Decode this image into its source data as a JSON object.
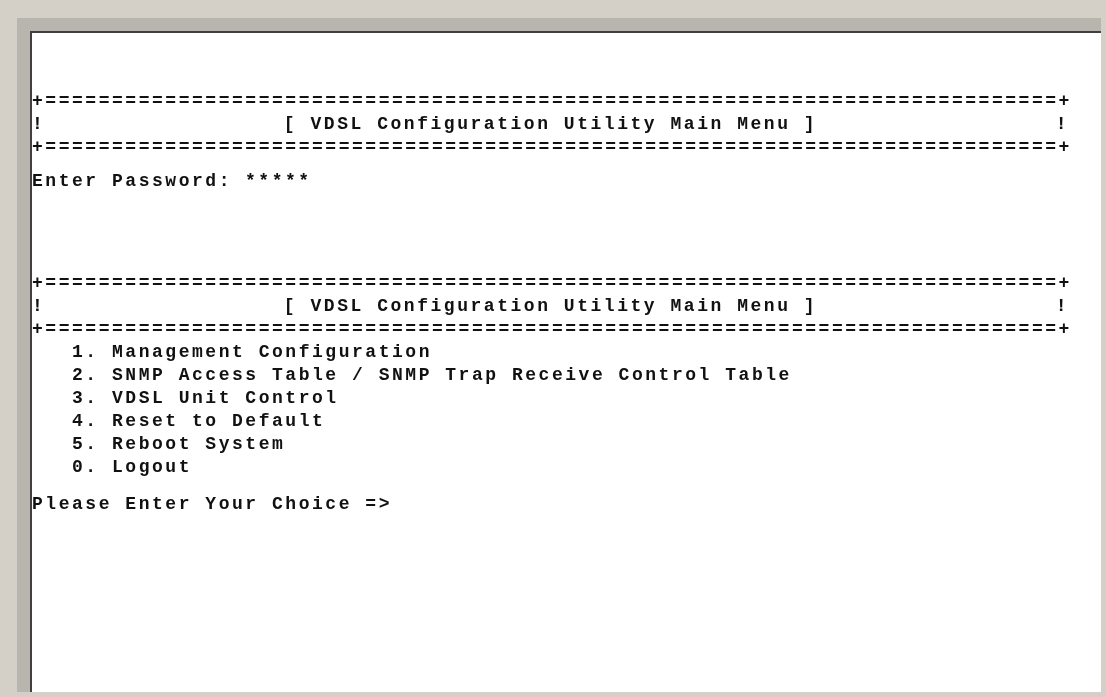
{
  "screens": [
    {
      "border_top": "+============================================================================+",
      "left_edge": "!",
      "title": "[ VDSL Configuration Utility Main Menu ]",
      "right_edge": "!",
      "border_bottom": "+============================================================================+"
    },
    {
      "border_top": "+============================================================================+",
      "left_edge": "!",
      "title": "[ VDSL Configuration Utility Main Menu ]",
      "right_edge": "!",
      "border_bottom": "+============================================================================+"
    }
  ],
  "password": {
    "label": "Enter Password:",
    "value": "*****"
  },
  "menu_items": [
    "1. Management Configuration",
    "2. SNMP Access Table / SNMP Trap Receive Control Table",
    "3. VDSL Unit Control",
    "4. Reset to Default",
    "5. Reboot System",
    "0. Logout"
  ],
  "prompt": "Please Enter Your Choice =>"
}
